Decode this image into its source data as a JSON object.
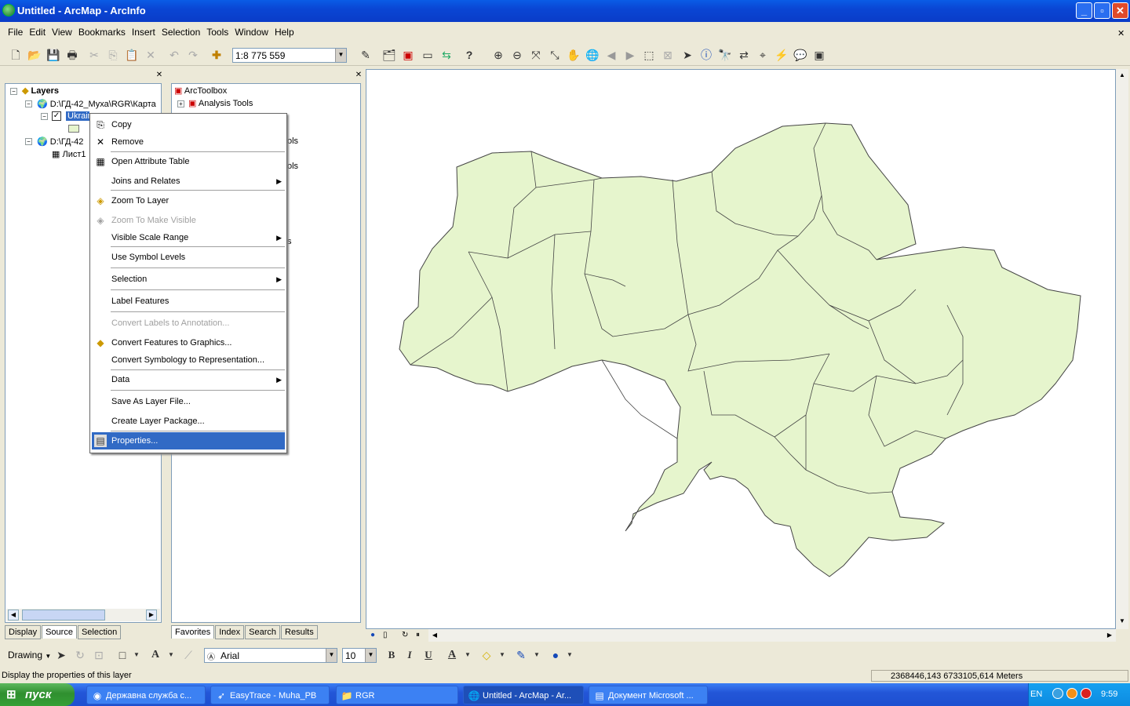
{
  "window": {
    "title": "Untitled - ArcMap - ArcInfo"
  },
  "menu": [
    "File",
    "Edit",
    "View",
    "Bookmarks",
    "Insert",
    "Selection",
    "Tools",
    "Window",
    "Help"
  ],
  "toolbar": {
    "scale": "1:8 775 559"
  },
  "toc": {
    "root": "Layers",
    "frame1": "D:\\ГД-42_Муха\\RGR\\Карта",
    "layer": "Ukrain",
    "frame2": "D:\\ГД-42",
    "table": "Лист1",
    "tabs": [
      "Display",
      "Source",
      "Selection"
    ]
  },
  "toolbox": {
    "root": "ArcToolbox",
    "first": "Analysis Tools",
    "partial1": "ols",
    "partial2": "ols",
    "partial3": "s",
    "tabs": [
      "Favorites",
      "Index",
      "Search",
      "Results"
    ]
  },
  "context_menu": {
    "items": [
      {
        "label": "Copy",
        "icon": "copy-icon",
        "disabled": false
      },
      {
        "label": "Remove",
        "icon": "remove-icon",
        "disabled": false
      },
      {
        "label": "Open Attribute Table",
        "icon": "table-icon",
        "disabled": false
      },
      {
        "label": "Joins and Relates",
        "submenu": true
      },
      {
        "label": "Zoom To Layer",
        "icon": "zoom-layer-icon"
      },
      {
        "label": "Zoom To Make Visible",
        "icon": "zoom-visible-icon",
        "disabled": true
      },
      {
        "label": "Visible Scale Range",
        "submenu": true
      },
      {
        "label": "Use Symbol Levels"
      },
      {
        "label": "Selection",
        "submenu": true
      },
      {
        "label": "Label Features"
      },
      {
        "label": "Convert Labels to Annotation...",
        "disabled": true
      },
      {
        "label": "Convert Features to Graphics...",
        "icon": "convert-icon"
      },
      {
        "label": "Convert Symbology to Representation..."
      },
      {
        "label": "Data",
        "submenu": true
      },
      {
        "label": "Save As Layer File..."
      },
      {
        "label": "Create Layer Package..."
      },
      {
        "label": "Properties...",
        "icon": "properties-icon",
        "highlighted": true
      }
    ]
  },
  "drawing_toolbar": {
    "label": "Drawing",
    "font": "Arial",
    "size": "10",
    "bold": "B",
    "italic": "I",
    "underline": "U",
    "font_color": "A"
  },
  "status": {
    "message": "Display the properties of this layer",
    "coords": "2368446,143  6733105,614 Meters"
  },
  "taskbar": {
    "start": "пуск",
    "tasks": [
      "Державна служба с...",
      "EasyTrace - Muha_PB",
      "RGR",
      "Untitled - ArcMap - Ar...",
      "Документ Microsoft ..."
    ],
    "lang": "EN",
    "time": "9:59"
  },
  "colors": {
    "map_fill": "#e6f5cd",
    "selection": "#316ac5",
    "titlebar": "#0a46d4"
  }
}
